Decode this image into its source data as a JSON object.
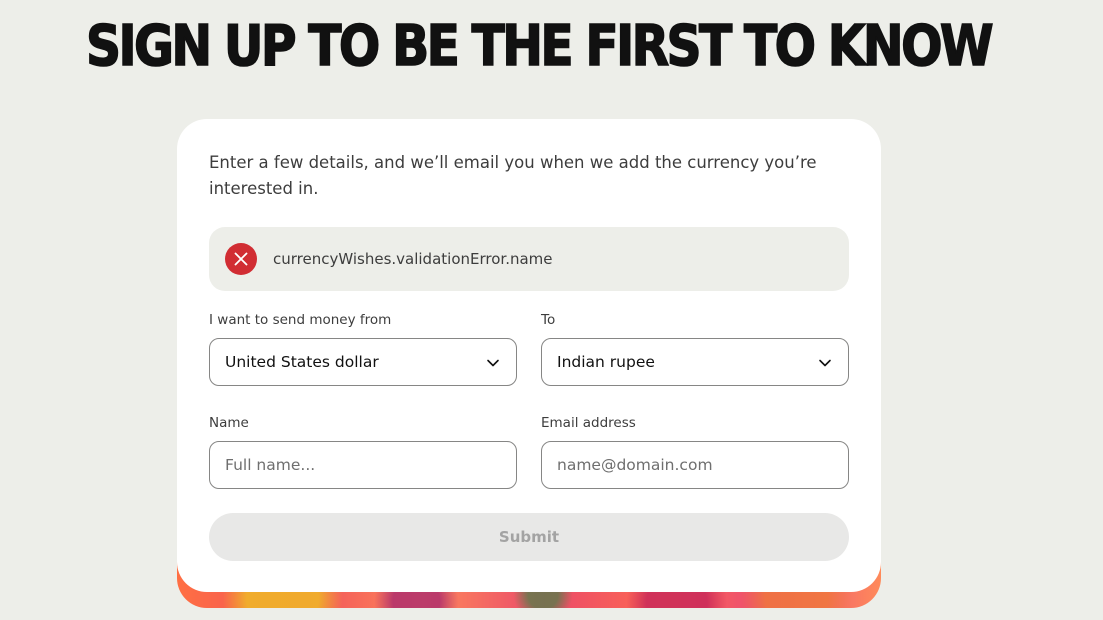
{
  "headline": "SIGN UP TO BE THE FIRST TO KNOW",
  "form": {
    "intro": "Enter a few details, and we’ll email you when we add the currency you’re interested in.",
    "error": {
      "icon": "error-x-icon",
      "message": "currencyWishes.validationError.name",
      "color": "#d12d33"
    },
    "from": {
      "label": "I want to send money from",
      "value": "United States dollar",
      "icon": "chevron-down-icon"
    },
    "to": {
      "label": "To",
      "value": "Indian rupee",
      "icon": "chevron-down-icon"
    },
    "name": {
      "label": "Name",
      "placeholder": "Full name...",
      "value": ""
    },
    "email": {
      "label": "Email address",
      "placeholder": "name@domain.com",
      "value": ""
    },
    "submit": {
      "label": "Submit",
      "state": "disabled"
    }
  },
  "colors": {
    "page_background": "#edeee9",
    "card_background": "#ffffff",
    "error": "#d12d33",
    "text_primary": "#111111",
    "text_secondary": "#3d3d3d",
    "button_disabled_background": "#e8e8e7",
    "button_disabled_text": "#a3a3a3"
  }
}
